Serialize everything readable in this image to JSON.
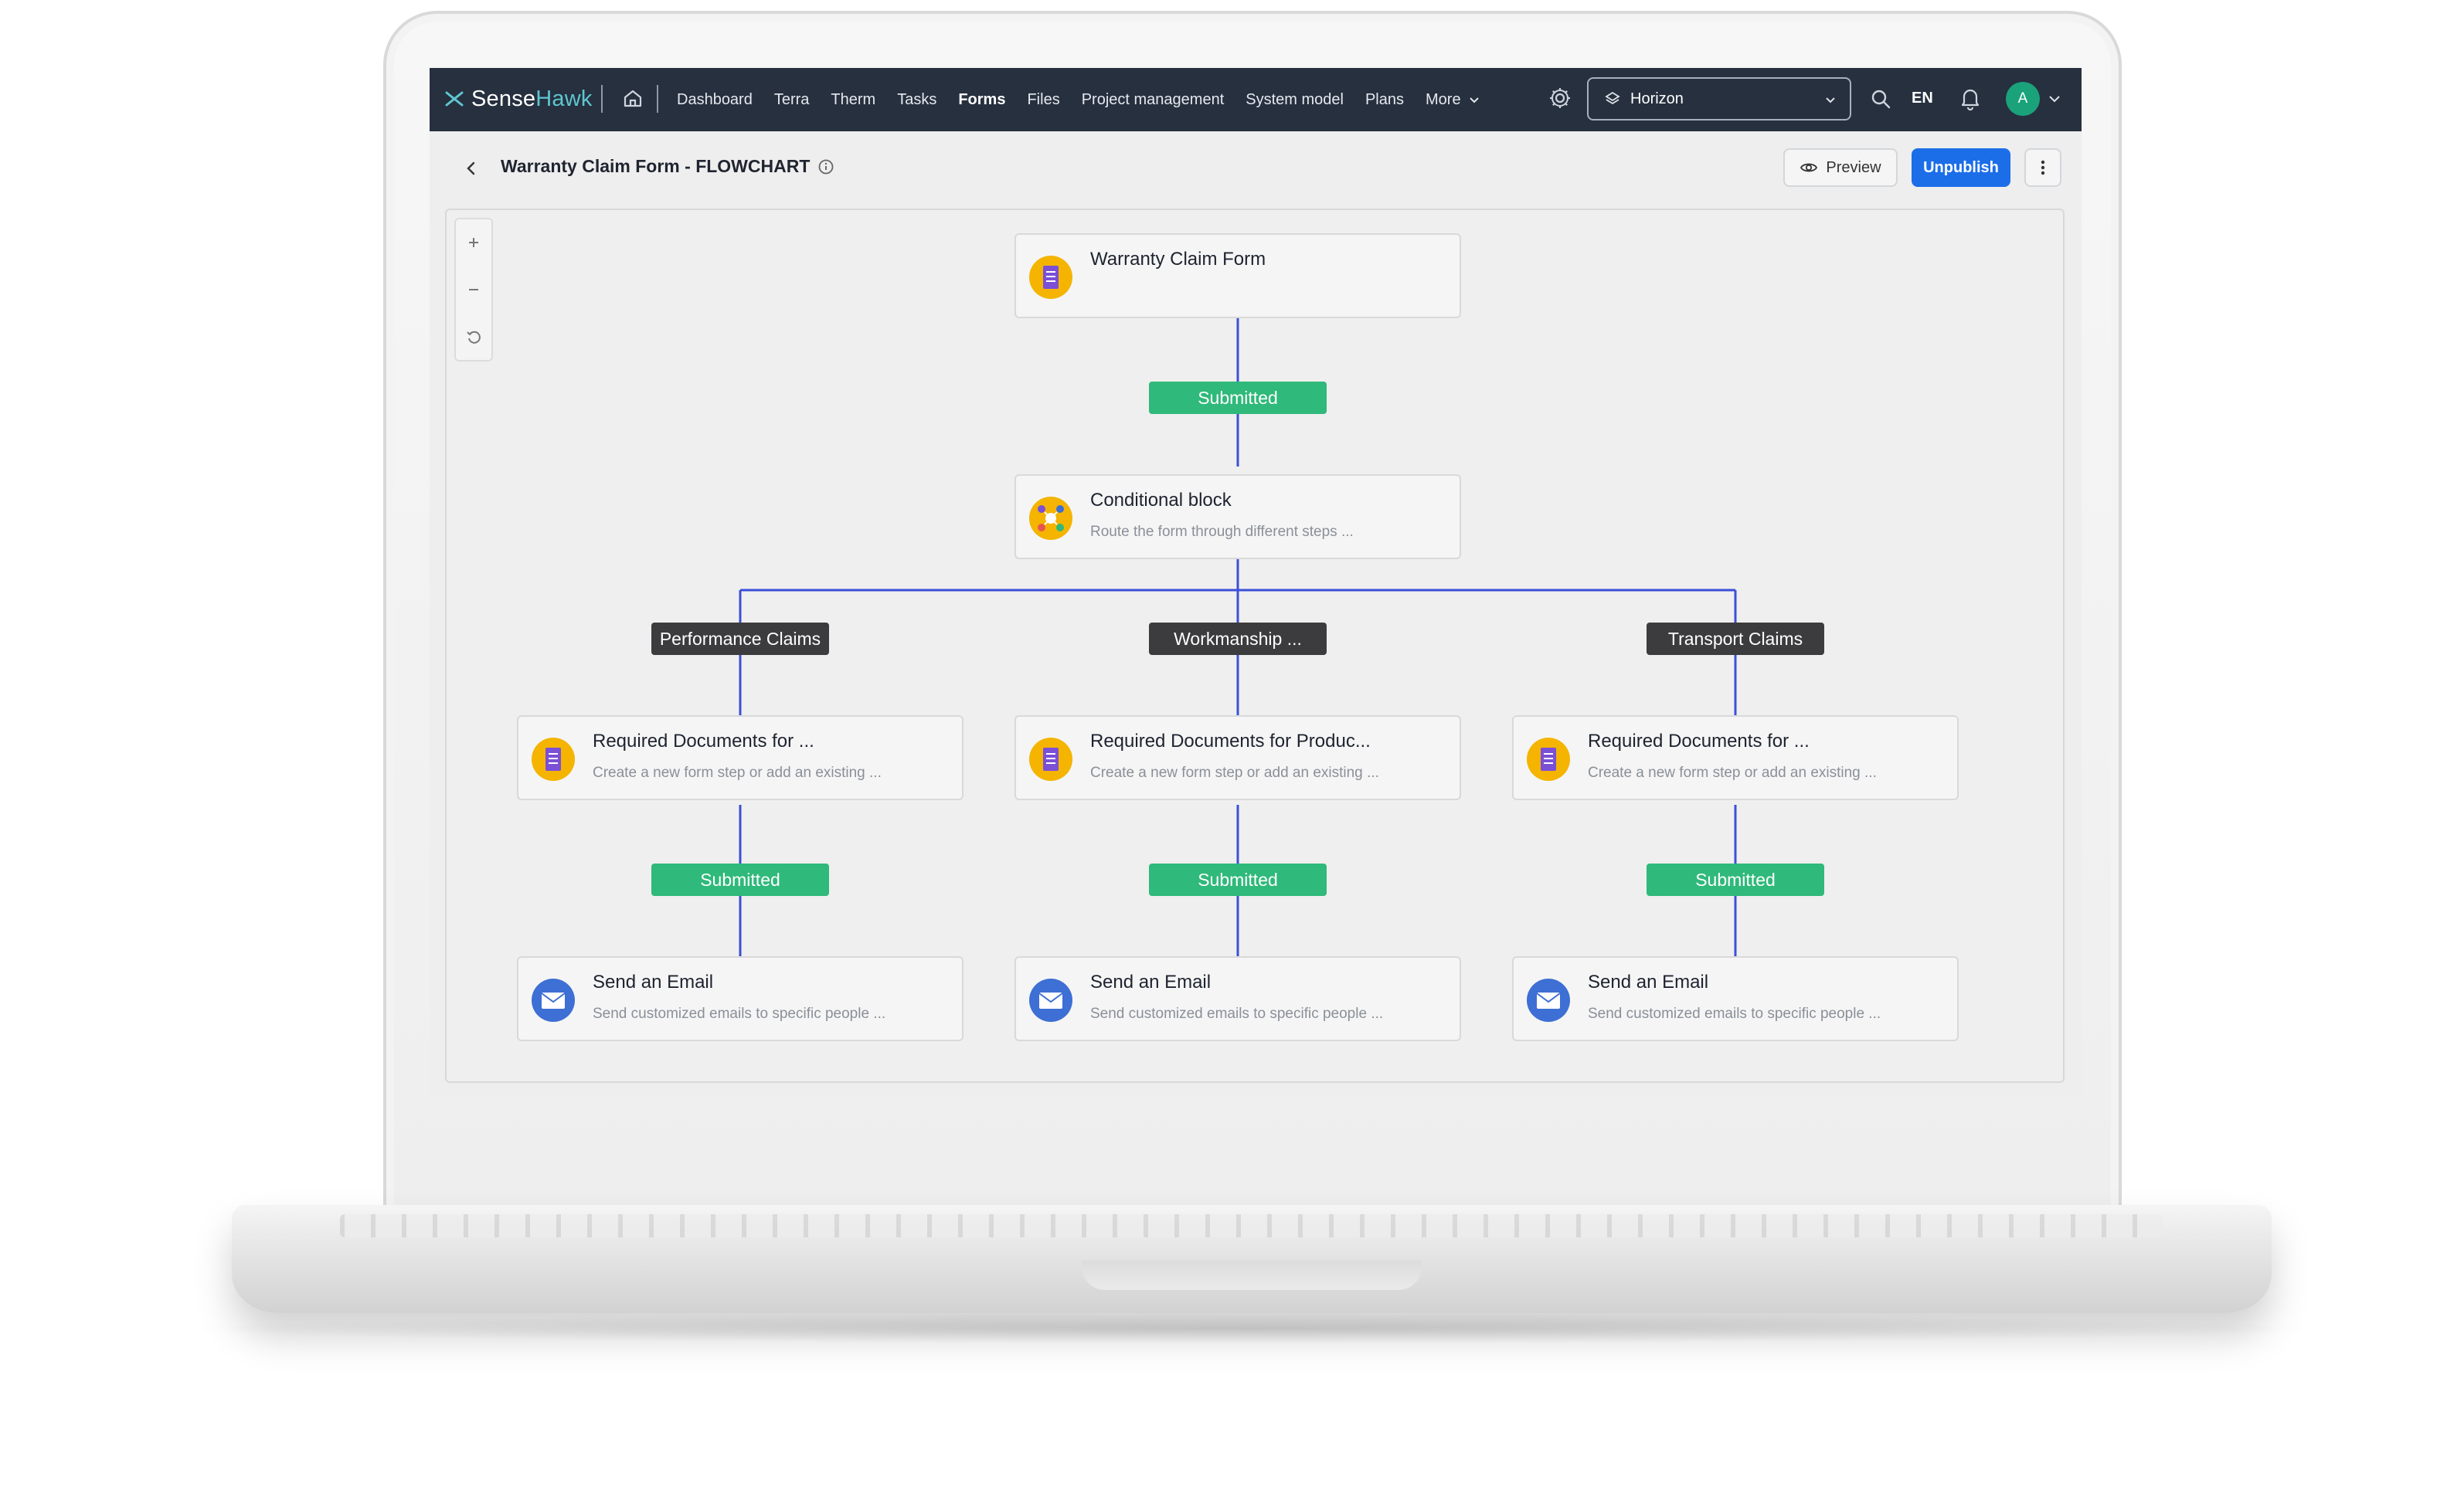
{
  "brand": {
    "name_part1": "Sense",
    "name_part2": "Hawk",
    "accent": "#5fc6cf"
  },
  "nav": {
    "items": [
      {
        "label": "Dashboard",
        "active": false
      },
      {
        "label": "Terra",
        "active": false
      },
      {
        "label": "Therm",
        "active": false
      },
      {
        "label": "Tasks",
        "active": false
      },
      {
        "label": "Forms",
        "active": true
      },
      {
        "label": "Files",
        "active": false
      },
      {
        "label": "Project management",
        "active": false
      },
      {
        "label": "System model",
        "active": false
      },
      {
        "label": "Plans",
        "active": false
      }
    ],
    "more_label": "More",
    "project_selected": "Horizon",
    "language": "EN",
    "avatar_initial": "A"
  },
  "page": {
    "title": "Warranty Claim Form - FLOWCHART",
    "preview_label": "Preview",
    "unpublish_label": "Unpublish"
  },
  "flowchart": {
    "start_node": {
      "title": "Warranty Claim Form",
      "icon": "form-icon"
    },
    "first_status": "Submitted",
    "conditional": {
      "title": "Conditional block",
      "desc": "Route the form through different steps ...",
      "icon": "conditional-icon"
    },
    "branches": [
      {
        "label": "Performance Claims",
        "step": {
          "title": "Required Documents for ...",
          "desc": "Create a new form step or add an existing ..."
        },
        "status": "Submitted",
        "email": {
          "title": "Send an Email",
          "desc": "Send customized emails to specific people ..."
        }
      },
      {
        "label": "Workmanship ...",
        "step": {
          "title": "Required Documents for Produc...",
          "desc": "Create a new form step or add an existing ..."
        },
        "status": "Submitted",
        "email": {
          "title": "Send an Email",
          "desc": "Send customized emails to specific people ..."
        }
      },
      {
        "label": "Transport Claims",
        "step": {
          "title": "Required Documents for ...",
          "desc": "Create a new form step or add an existing ..."
        },
        "status": "Submitted",
        "email": {
          "title": "Send an Email",
          "desc": "Send customized emails to specific people ..."
        }
      }
    ]
  },
  "colors": {
    "navbar": "#26303f",
    "primary": "#1b6ee8",
    "submitted": "#2fb97a",
    "branch": "#3c3c3e",
    "connector": "#3b4fd8",
    "form_icon_bg": "#f4b400",
    "form_icon_doc": "#7b4fd6",
    "email_icon": "#3d6fd4"
  }
}
